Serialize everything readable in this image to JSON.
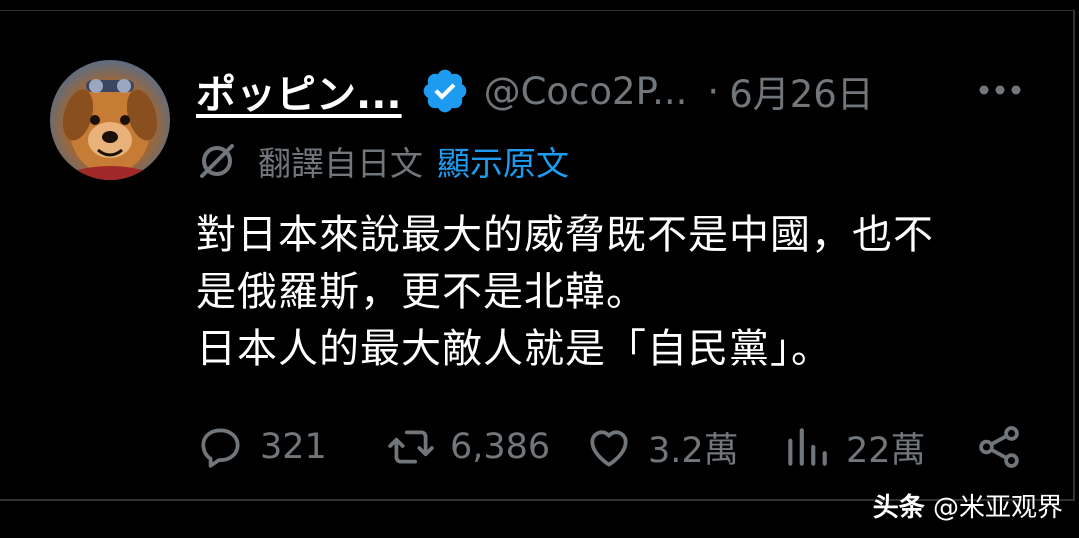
{
  "post": {
    "display_name": "ポッピン...",
    "handle": "@Coco2P...",
    "separator": "·",
    "date": "6月26日",
    "translation_label": "翻譯自日文",
    "translation_link": "顯示原文",
    "text_lines": [
      "對日本來說最大的威脅既不是中國，也不",
      "是俄羅斯，更不是北韓。",
      "日本人的最大敵人就是「自民黨」。"
    ],
    "stats": {
      "replies": "321",
      "reposts": "6,386",
      "likes": "3.2萬",
      "views": "22萬"
    }
  },
  "watermark": {
    "brand": "头条",
    "account": "@米亚观界"
  },
  "colors": {
    "background": "#000000",
    "text": "#ffffff",
    "muted": "#71767b",
    "accent": "#1d9bf0"
  },
  "icons": [
    "verified-badge-icon",
    "more-icon",
    "translate-icon",
    "reply-icon",
    "repost-icon",
    "like-icon",
    "views-icon",
    "share-icon"
  ]
}
